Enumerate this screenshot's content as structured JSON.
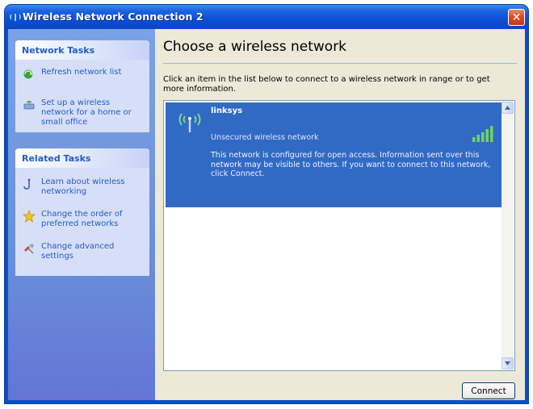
{
  "window": {
    "title": "Wireless Network Connection 2",
    "close_glyph": "✕"
  },
  "sidebar": {
    "network_tasks": {
      "header": "Network Tasks",
      "items": [
        {
          "label": "Refresh network list",
          "icon": "refresh-icon"
        },
        {
          "label": "Set up a wireless network for a home or small office",
          "icon": "setup-network-icon"
        }
      ]
    },
    "related_tasks": {
      "header": "Related Tasks",
      "items": [
        {
          "label": "Learn about wireless networking",
          "icon": "help-icon"
        },
        {
          "label": "Change the order of preferred networks",
          "icon": "star-icon"
        },
        {
          "label": "Change advanced settings",
          "icon": "settings-icon"
        }
      ]
    }
  },
  "main": {
    "heading": "Choose a wireless network",
    "instruction": "Click an item in the list below to connect to a wireless network in range or to get more information.",
    "networks": [
      {
        "name": "linksys",
        "security": "Unsecured wireless network",
        "description": "This network is configured for open access. Information sent over this network may be visible to others. If you want to connect to this network, click Connect.",
        "signal_bars": 5,
        "icon": "wireless-antenna-icon"
      }
    ],
    "connect_label": "Connect"
  },
  "colors": {
    "selected_item": "#316ac5",
    "sidebar_link": "#215dc6",
    "titlebar": "#0a46c4"
  }
}
